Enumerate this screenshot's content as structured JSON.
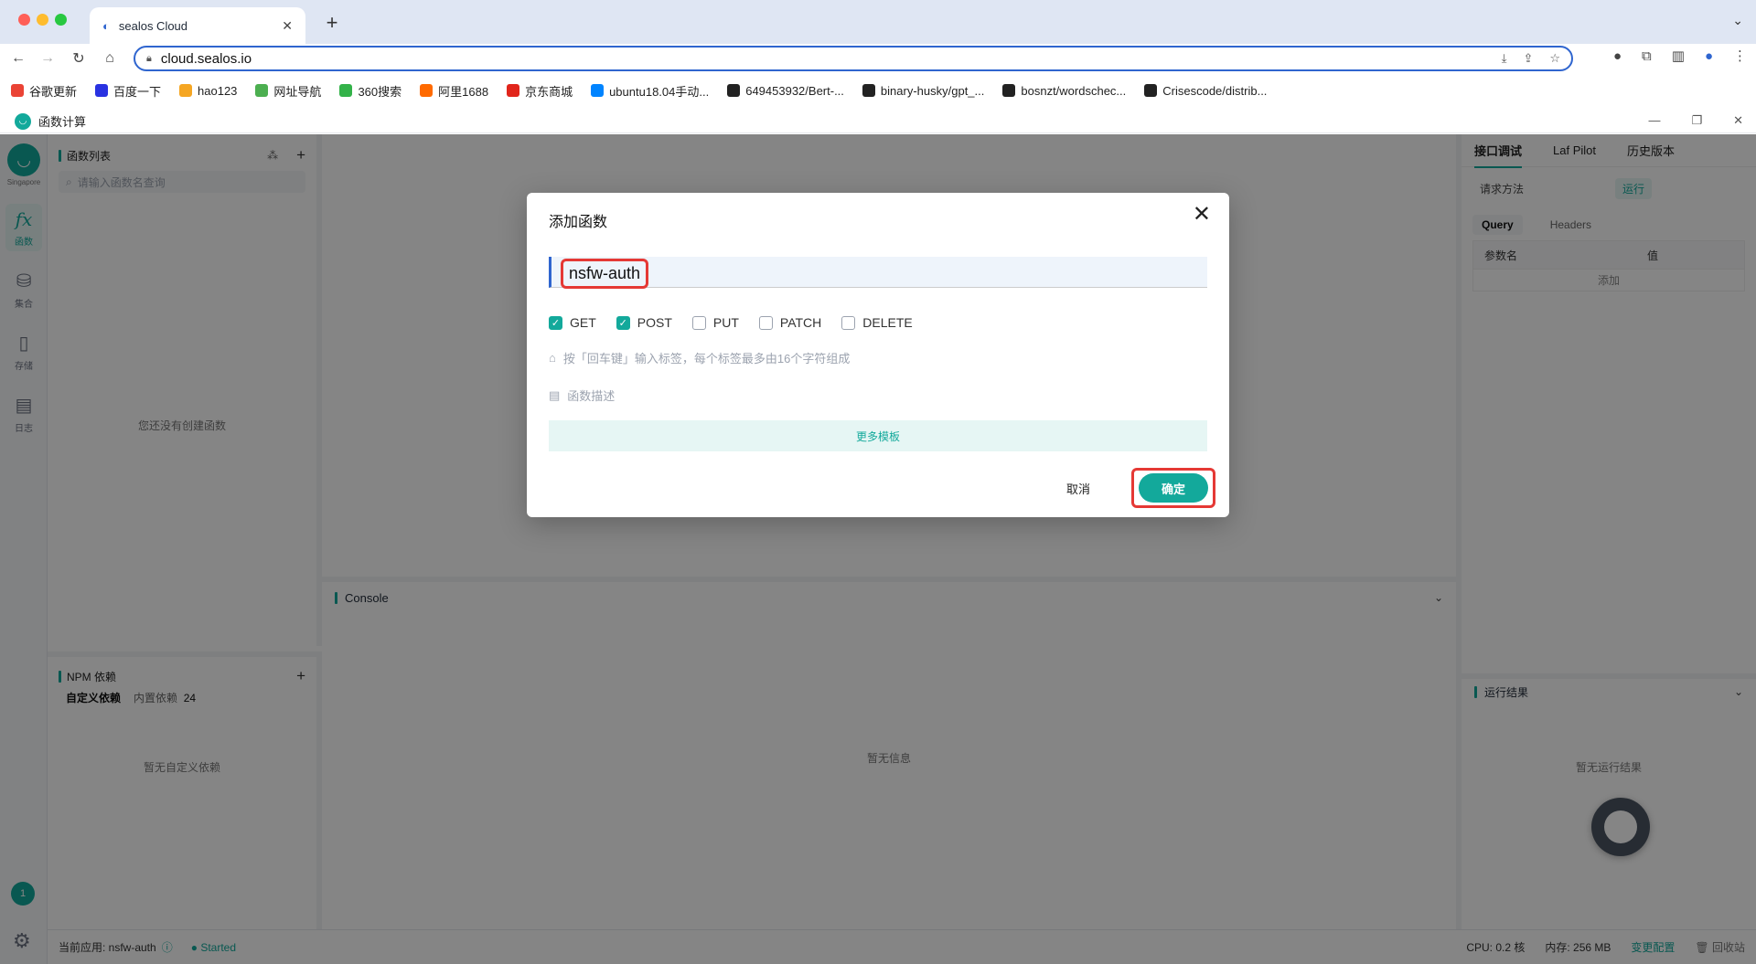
{
  "browser": {
    "tab_title": "sealos Cloud",
    "url": "cloud.sealos.io",
    "bookmarks": [
      {
        "label": "谷歌更新",
        "icon": "chrome-icon",
        "color": "#ea4335"
      },
      {
        "label": "百度一下",
        "icon": "baidu-icon",
        "color": "#2932e1"
      },
      {
        "label": "hao123",
        "icon": "hao123-icon",
        "color": "#f5a623"
      },
      {
        "label": "网址导航",
        "icon": "nav-icon",
        "color": "#4caf50"
      },
      {
        "label": "360搜索",
        "icon": "360-icon",
        "color": "#33b249"
      },
      {
        "label": "阿里1688",
        "icon": "ali-icon",
        "color": "#ff6a00"
      },
      {
        "label": "京东商城",
        "icon": "jd-icon",
        "color": "#e1251b"
      },
      {
        "label": "ubuntu18.04手动...",
        "icon": "zhihu-icon",
        "color": "#0084ff"
      },
      {
        "label": "649453932/Bert-...",
        "icon": "github-icon",
        "color": "#222222"
      },
      {
        "label": "binary-husky/gpt_...",
        "icon": "github-icon",
        "color": "#222222"
      },
      {
        "label": "bosnzt/wordschec...",
        "icon": "github-icon",
        "color": "#222222"
      },
      {
        "label": "Crisescode/distrib...",
        "icon": "github-icon",
        "color": "#222222"
      }
    ]
  },
  "appbar": {
    "title": "函数计算"
  },
  "leftnav": {
    "region": "Singapore",
    "items": [
      {
        "label": "函数",
        "icon": "function-icon"
      },
      {
        "label": "集合",
        "icon": "database-icon"
      },
      {
        "label": "存储",
        "icon": "storage-icon"
      },
      {
        "label": "日志",
        "icon": "log-icon"
      }
    ],
    "user_badge": "1"
  },
  "functions": {
    "title": "函数列表",
    "search_placeholder": "请输入函数名查询",
    "empty": "您还没有创建函数"
  },
  "npm": {
    "title": "NPM 依赖",
    "tab_custom": "自定义依赖",
    "tab_builtin": "内置依赖",
    "builtin_count": "24",
    "empty": "暂无自定义依赖"
  },
  "console": {
    "title": "Console",
    "empty": "暂无信息"
  },
  "right": {
    "tabs": [
      "接口调试",
      "Laf Pilot",
      "历史版本"
    ],
    "request_method_label": "请求方法",
    "run_label": "运行",
    "query_tab": "Query",
    "headers_tab": "Headers",
    "param_name": "参数名",
    "param_value": "值",
    "add_label": "添加",
    "result_title": "运行结果",
    "result_empty": "暂无运行结果"
  },
  "status": {
    "current_app": "当前应用: nsfw-auth",
    "state": "Started",
    "cpu": "CPU: 0.2 核",
    "memory": "内存: 256 MB",
    "change_config": "变更配置",
    "recycle": "回收站"
  },
  "modal": {
    "title": "添加函数",
    "name_value": "nsfw-auth",
    "methods": [
      {
        "label": "GET",
        "checked": true
      },
      {
        "label": "POST",
        "checked": true
      },
      {
        "label": "PUT",
        "checked": false
      },
      {
        "label": "PATCH",
        "checked": false
      },
      {
        "label": "DELETE",
        "checked": false
      }
    ],
    "tag_placeholder": "按「回车键」输入标签，每个标签最多由16个字符组成",
    "desc_placeholder": "函数描述",
    "more_templates": "更多模板",
    "cancel": "取消",
    "confirm": "确定"
  },
  "colors": {
    "accent": "#13a99b",
    "highlight": "#e53935",
    "focus": "#2f65cf"
  }
}
